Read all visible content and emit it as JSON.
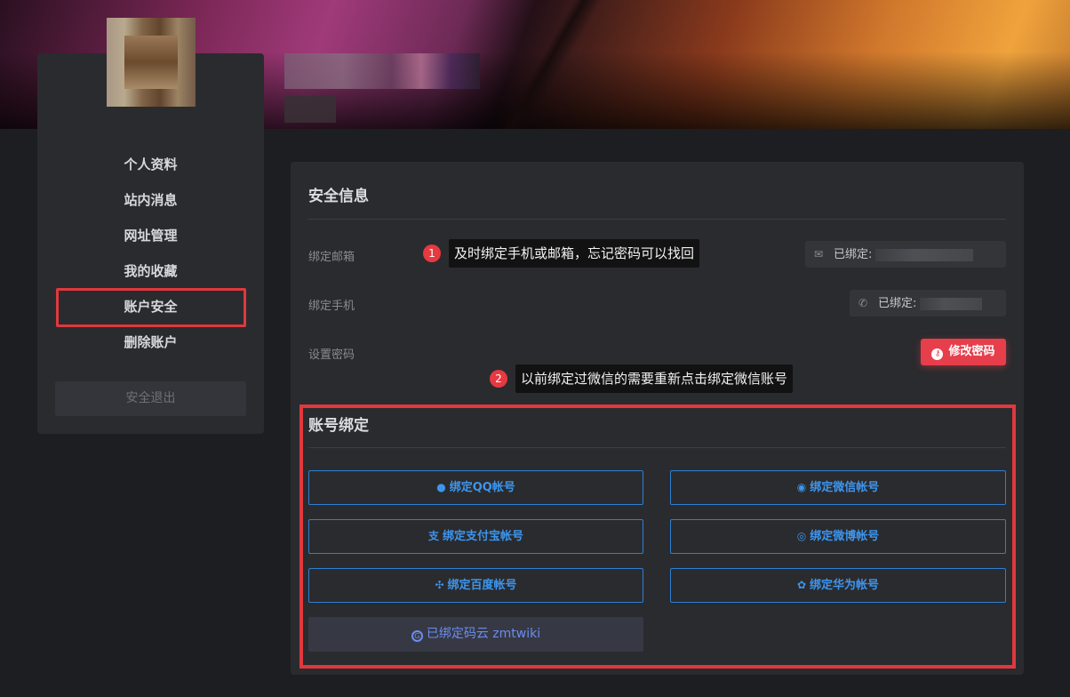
{
  "sidebar": {
    "items": [
      {
        "label": "个人资料"
      },
      {
        "label": "站内消息"
      },
      {
        "label": "网址管理"
      },
      {
        "label": "我的收藏"
      },
      {
        "label": "账户安全"
      },
      {
        "label": "删除账户"
      }
    ],
    "logout_label": "安全退出"
  },
  "security": {
    "title": "安全信息",
    "email_label": "绑定邮箱",
    "email_status": "已绑定:",
    "phone_label": "绑定手机",
    "phone_status": "已绑定:",
    "password_label": "设置密码",
    "password_button": "修改密码"
  },
  "callouts": [
    {
      "num": "1",
      "text": "及时绑定手机或邮箱，忘记密码可以找回"
    },
    {
      "num": "2",
      "text": "以前绑定过微信的需要重新点击绑定微信账号"
    }
  ],
  "bindings": {
    "title": "账号绑定",
    "buttons": [
      {
        "label": "绑定QQ帐号",
        "icon": "qq-icon"
      },
      {
        "label": "绑定微信帐号",
        "icon": "wechat-icon"
      },
      {
        "label": "绑定支付宝帐号",
        "icon": "alipay-icon"
      },
      {
        "label": "绑定微博帐号",
        "icon": "weibo-icon"
      },
      {
        "label": "绑定百度帐号",
        "icon": "baidu-icon"
      },
      {
        "label": "绑定华为帐号",
        "icon": "huawei-icon"
      }
    ],
    "bound_label": "已绑定码云 zmtwiki"
  },
  "colors": {
    "accent_red": "#e63e4b",
    "link_blue": "#3d95ee",
    "card_bg": "#2a2b2e",
    "page_bg": "#1d1e21"
  }
}
